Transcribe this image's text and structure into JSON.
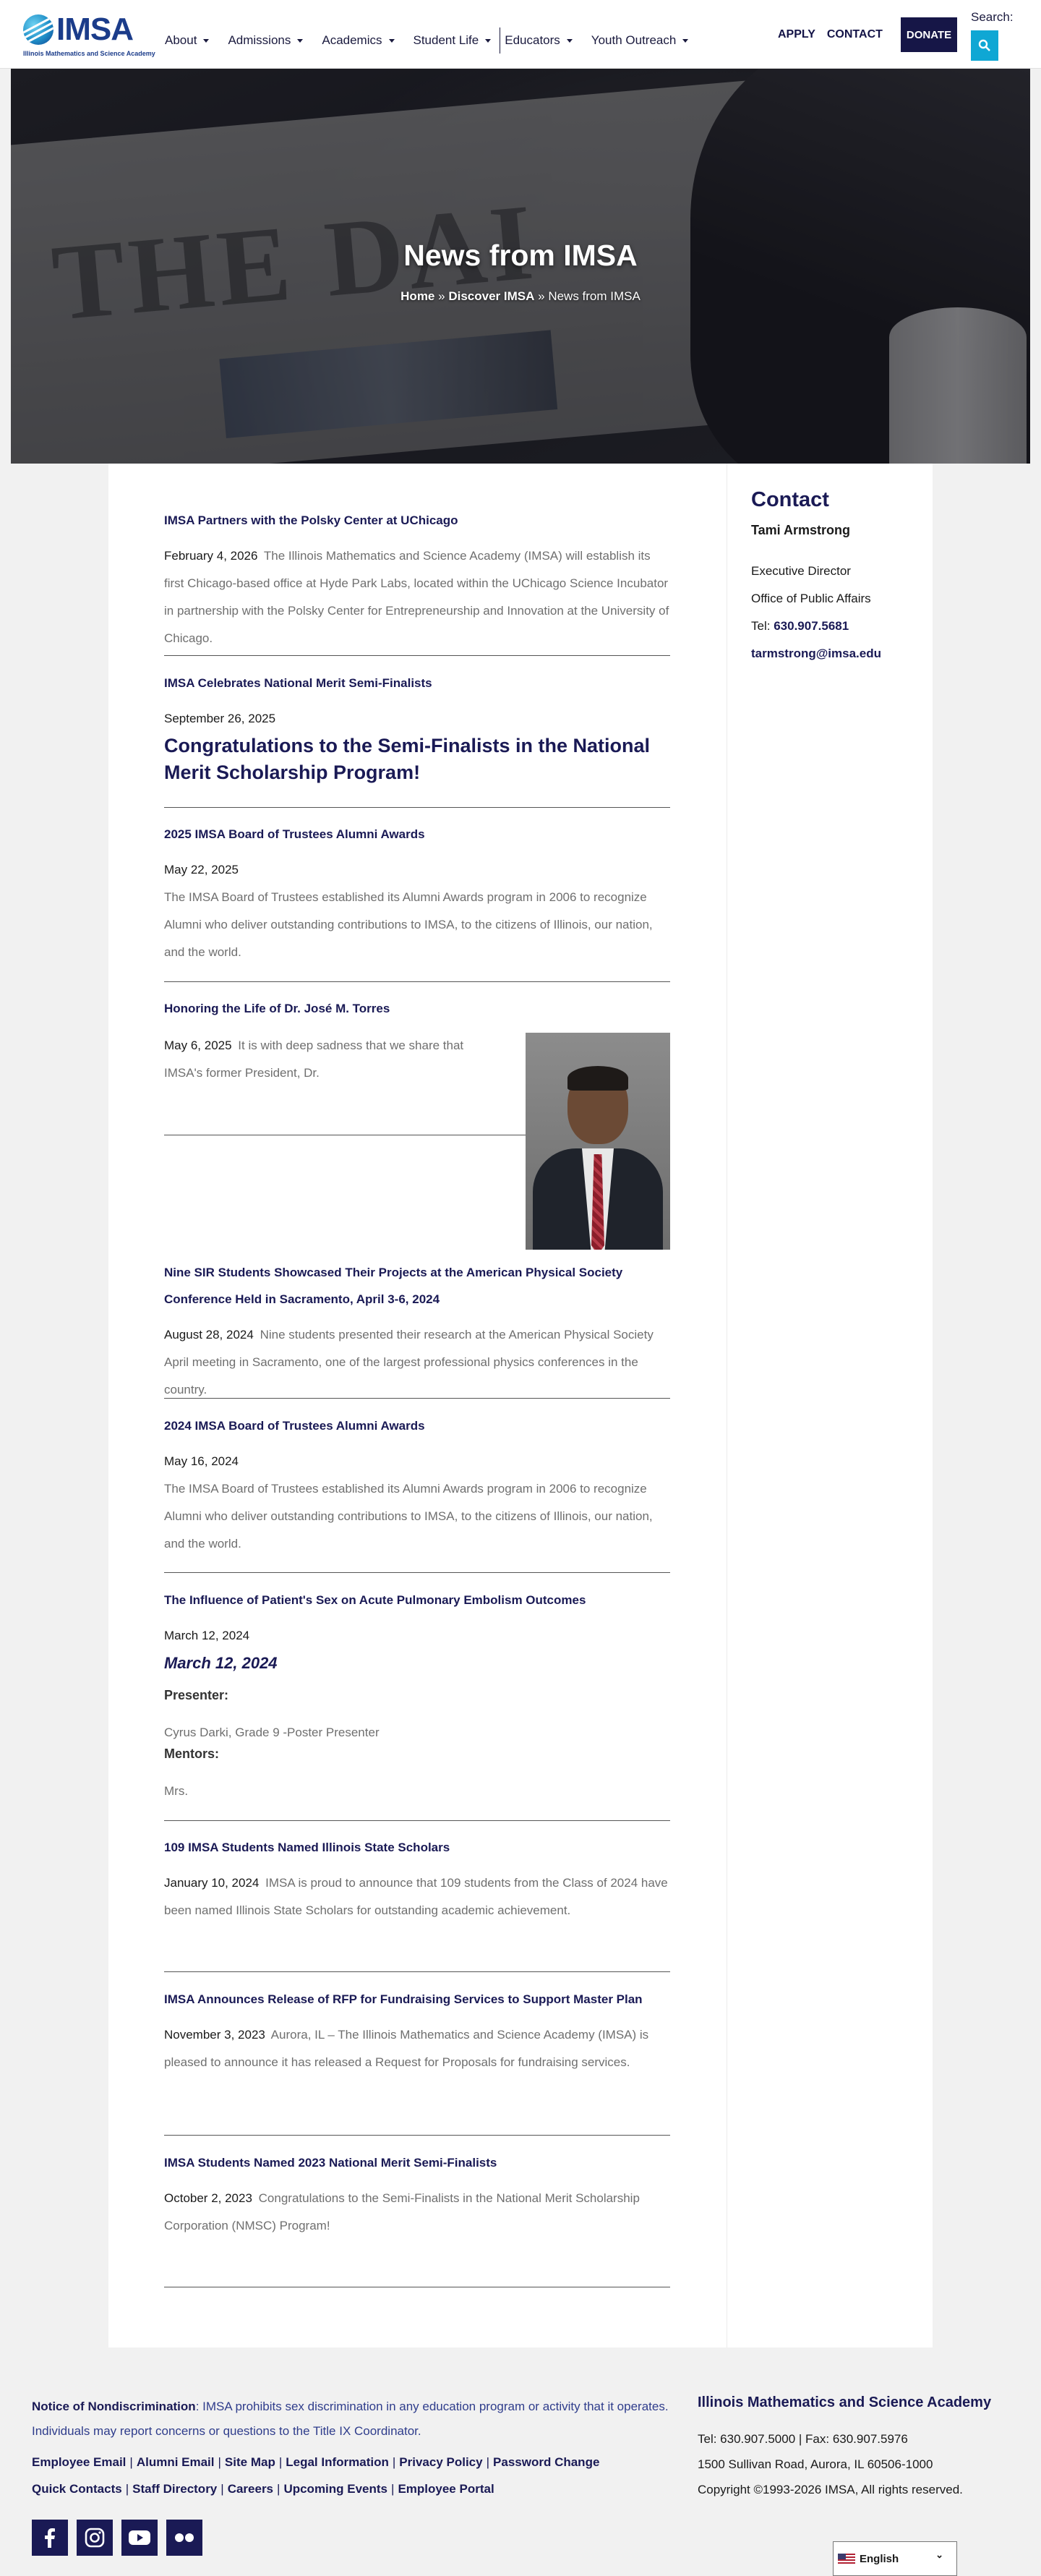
{
  "header": {
    "logo_text": "IMSA",
    "logo_sub": "Illinois Mathematics and Science Academy",
    "nav": [
      {
        "label": "About"
      },
      {
        "label": "Admissions"
      },
      {
        "label": "Academics"
      },
      {
        "label": "Student Life"
      },
      {
        "label": "Educators"
      },
      {
        "label": "Youth Outreach"
      }
    ],
    "apply_label": "APPLY",
    "contact_label": "CONTACT",
    "donate_label": "DONATE",
    "search_label": "Search:"
  },
  "hero": {
    "title": "News from IMSA",
    "breadcrumb": {
      "home": "Home",
      "sep": "»",
      "discover": "Discover IMSA",
      "current": "News from IMSA"
    }
  },
  "posts": [
    {
      "title": "IMSA Partners with the Polsky Center at UChicago",
      "date": "February 4, 2026",
      "excerpt": "The Illinois Mathematics and Science Academy (IMSA) will establish its first Chicago-based office at Hyde Park Labs, located within the UChicago Science Incubator in partnership with the Polsky Center for Entrepreneurship and Innovation at the University of Chicago."
    },
    {
      "title": "IMSA Celebrates National Merit Semi-Finalists",
      "date": "September 26, 2025",
      "headline": "Congratulations to the Semi-Finalists in the National Merit Scholarship Program!"
    },
    {
      "title": "2025 IMSA Board of Trustees Alumni Awards",
      "date": "May 22, 2025",
      "excerpt": "The IMSA Board of Trustees established its Alumni Awards program in 2006 to recognize Alumni who deliver outstanding contributions to IMSA, to the citizens of Illinois, our nation, and the world."
    },
    {
      "title": "Honoring the Life of Dr. José M. Torres",
      "date": "May 6, 2025",
      "excerpt": "It is with deep sadness that we share that IMSA's former President, Dr."
    },
    {
      "title": "Nine SIR Students Showcased Their Projects at the American Physical Society Conference Held in Sacramento, April 3-6, 2024",
      "date": "August 28, 2024",
      "excerpt": "Nine students presented their research at the American Physical Society April meeting in Sacramento, one of the largest professional physics conferences in the country."
    },
    {
      "title": "2024 IMSA Board of Trustees Alumni Awards",
      "date": "May 16, 2024",
      "excerpt": "The IMSA Board of Trustees established its Alumni Awards program in 2006 to recognize Alumni who deliver outstanding contributions to IMSA, to the citizens of Illinois, our nation, and the world."
    },
    {
      "title": "The Influence of Patient's Sex on Acute Pulmonary Embolism Outcomes",
      "date": "March 12, 2024",
      "headline": "March 12, 2024",
      "presenter_label": "Presenter:",
      "presenter": "Cyrus Darki, Grade 9 -Poster Presenter",
      "mentors_label": "Mentors:",
      "mentors": "Mrs."
    },
    {
      "title": "109 IMSA Students Named Illinois State Scholars",
      "date": "January 10, 2024",
      "excerpt": "IMSA is proud to announce that 109 students from the Class of 2024 have been named Illinois State Scholars for outstanding academic achievement."
    },
    {
      "title": "IMSA Announces Release of RFP for Fundraising Services to Support Master Plan",
      "date": "November 3, 2023",
      "excerpt": "Aurora, IL – The Illinois Mathematics and Science Academy (IMSA) is pleased to announce it has released a Request for Proposals for fundraising services."
    },
    {
      "title": "IMSA Students Named 2023 National Merit Semi-Finalists",
      "date": "October 2, 2023",
      "excerpt": "Congratulations to the Semi-Finalists in the National Merit Scholarship Corporation (NMSC) Program!"
    }
  ],
  "sidebar": {
    "title": "Contact",
    "name": "Tami Armstrong",
    "role": "Executive Director",
    "office": "Office of Public Affairs",
    "tel_label": "Tel:",
    "tel": "630.907.5681",
    "email": "tarmstrong@imsa.edu"
  },
  "footer": {
    "notice_label": "Notice of Nondiscrimination",
    "notice_text": ": IMSA prohibits sex discrimination in any education program or activity that it operates. Individuals may report concerns or questions to the Title IX Coordinator.",
    "links_row1": [
      "Employee Email",
      "Alumni Email",
      "Site Map",
      "Legal Information",
      "Privacy Policy",
      "Password Change"
    ],
    "links_row2": [
      "Quick Contacts",
      "Staff Directory",
      "Careers",
      "Upcoming Events",
      "Employee Portal"
    ],
    "org_name": "Illinois Mathematics and Science Academy",
    "phone_line": "Tel: 630.907.5000 | Fax: 630.907.5976",
    "address": "1500 Sullivan Road, Aurora, IL 60506-1000",
    "copyright": "Copyright ©1993-2026 IMSA, All rights reserved.",
    "social": [
      "facebook-icon",
      "instagram-icon",
      "youtube-icon",
      "flickr-icon"
    ],
    "language": "English"
  },
  "colors": {
    "brand_navy": "#1a1a55",
    "accent_cyan": "#0fa7d4"
  }
}
